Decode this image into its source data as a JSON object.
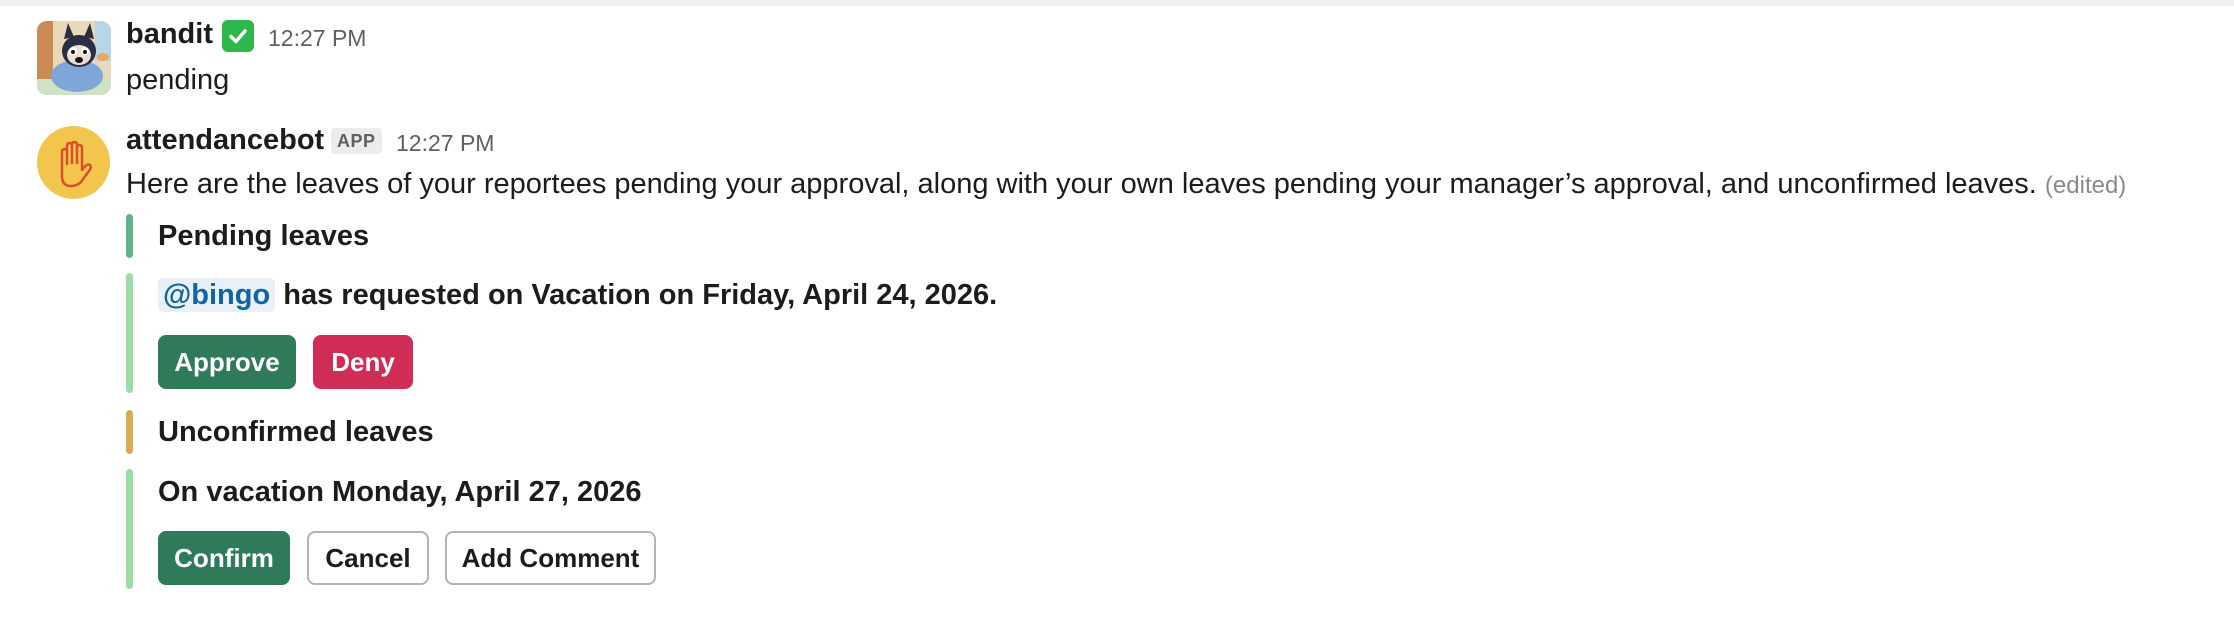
{
  "messages": [
    {
      "author": "bandit",
      "verified_icon": "white-check-mark-icon",
      "time": "12:27 PM",
      "text": "pending"
    },
    {
      "author": "attendancebot",
      "badge": "APP",
      "time": "12:27 PM",
      "text": "Here are the leaves of your reportees pending your approval, along with your own leaves pending your manager’s approval, and unconfirmed leaves.",
      "edited": "(edited)",
      "pending": {
        "heading": "Pending leaves",
        "mention": "@bingo",
        "request_text": "has requested on Vacation on Friday, April 24, 2026.",
        "approve_label": "Approve",
        "deny_label": "Deny"
      },
      "unconfirmed": {
        "heading": "Unconfirmed leaves",
        "leave_text": "On vacation Monday, April 27, 2026",
        "confirm_label": "Confirm",
        "cancel_label": "Cancel",
        "comment_label": "Add Comment"
      }
    }
  ],
  "colors": {
    "approve": "#2f7a59",
    "deny": "#cf2d55",
    "pending_bar": "#61b487",
    "request_bar": "#9fdca5",
    "unconfirmed_bar": "#d8ab57",
    "mention": "#1264a3"
  }
}
